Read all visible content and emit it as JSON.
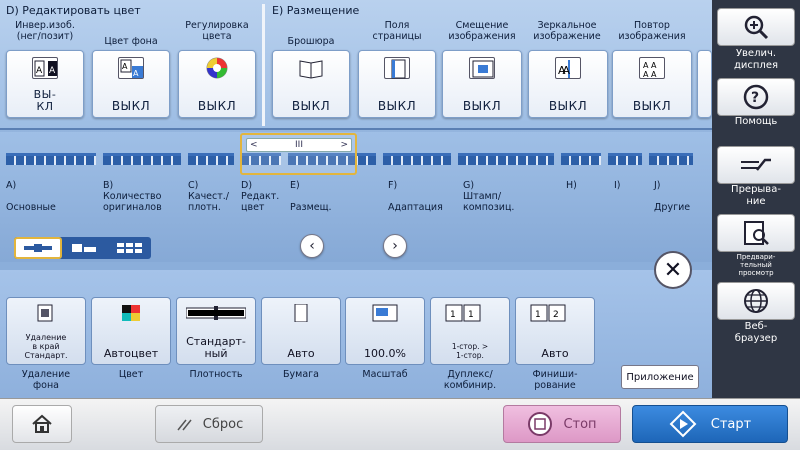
{
  "sections": {
    "color": {
      "title": "D)  Редактировать цвет"
    },
    "layout": {
      "title": "E)  Размещение"
    }
  },
  "color_functions": [
    {
      "label": "Инвер.изоб.\n(нег/позит)",
      "value": "ВЫ-\nКЛ",
      "icon": "invert-icon"
    },
    {
      "label": "Цвет фона",
      "value": "ВЫКЛ",
      "icon": "background-color-icon"
    },
    {
      "label": "Регулировка\nцвета",
      "value": "ВЫКЛ",
      "icon": "color-wheel-icon"
    }
  ],
  "layout_functions": [
    {
      "label": "Брошюра",
      "value": "ВЫКЛ",
      "icon": "booklet-icon"
    },
    {
      "label": "Поля\nстраницы",
      "value": "ВЫКЛ",
      "icon": "page-margin-icon"
    },
    {
      "label": "Смещение\nизображения",
      "value": "ВЫКЛ",
      "icon": "image-shift-icon"
    },
    {
      "label": "Зеркальное\nизображение",
      "value": "ВЫКЛ",
      "icon": "mirror-image-icon"
    },
    {
      "label": "Повтор\nизображения",
      "value": "ВЫКЛ",
      "icon": "repeat-image-icon"
    }
  ],
  "categories": [
    {
      "label": "A)\n\nОсновные"
    },
    {
      "label": "B)\nКоличество\nоригиналов"
    },
    {
      "label": "C)\nКачест./\nплотн."
    },
    {
      "label": "D)\nРедакт.\nцвет"
    },
    {
      "label": "E)\n\nРазмещ."
    },
    {
      "label": "F)\n\nАдаптация"
    },
    {
      "label": "G)\nШтамп/\nкомпозиц."
    },
    {
      "label": "H)"
    },
    {
      "label": "I)"
    },
    {
      "label": "J)\n\nДругие"
    }
  ],
  "scroller": {
    "left": "<",
    "mid": "III",
    "right": ">"
  },
  "quick_settings": [
    {
      "value": "Удаление\nв край\nСтандарт.",
      "label": "Удаление\nфона",
      "icon": "background-removal-icon"
    },
    {
      "value": "Автоцвет",
      "label": "Цвет",
      "icon": "auto-color-icon"
    },
    {
      "value": "Стандарт-\nный",
      "label": "Плотность",
      "icon": "density-icon"
    },
    {
      "value": "Авто",
      "label": "Бумага",
      "icon": "paper-icon"
    },
    {
      "value": "100.0%",
      "label": "Масштаб",
      "icon": "zoom-icon"
    },
    {
      "value": "1-стор. >\n1-стор.",
      "label": "Дуплекс/\nкомбинир.",
      "icon": "duplex-icon"
    },
    {
      "value": "Авто",
      "label": "Финиши-\nрование",
      "icon": "finishing-icon"
    }
  ],
  "application_button": "Приложение",
  "side_panel": [
    {
      "label": "Увелич.\nдисплея",
      "icon": "magnify-icon"
    },
    {
      "label": "Помощь",
      "icon": "help-icon"
    },
    {
      "label": "Прерыва-\nние",
      "icon": "interrupt-icon"
    },
    {
      "label": "Предвари-\nтельный\nпросмотр",
      "icon": "preview-icon"
    },
    {
      "label": "Веб-\nбраузер",
      "icon": "globe-icon"
    }
  ],
  "footer": {
    "reset": "Сброс",
    "stop": "Стоп",
    "start": "Старт"
  },
  "colors": {
    "accent_blue": "#2c5aa0",
    "highlight": "#e2b53d",
    "stop_pink": "#e6a9cf",
    "start_blue": "#2678c8"
  }
}
